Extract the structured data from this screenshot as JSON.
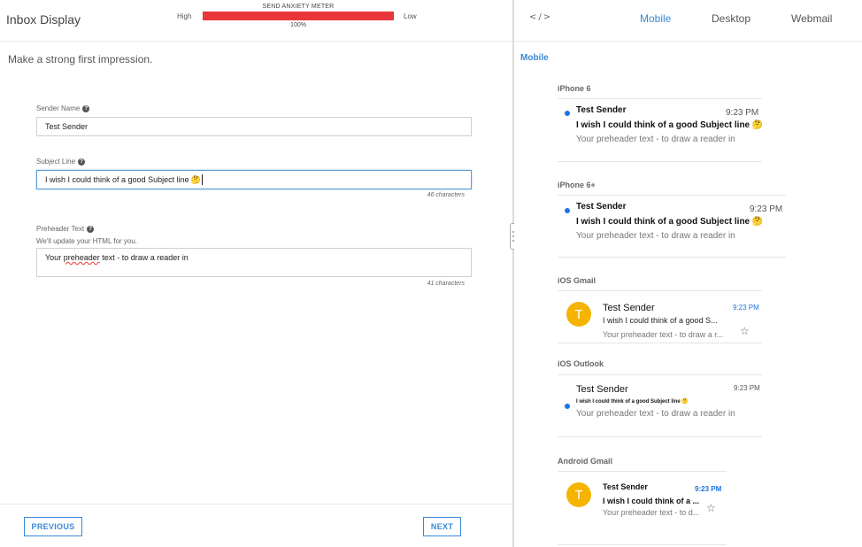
{
  "header": {
    "title": "Inbox Display",
    "meter": {
      "label": "SEND ANXIETY METER",
      "high": "High",
      "low": "Low",
      "percent_label": "100%",
      "percent": 100,
      "color": "#e8373b"
    }
  },
  "form": {
    "tagline": "Make a strong first impression.",
    "sender_name": {
      "label": "Sender Name",
      "value": "Test Sender"
    },
    "subject_line": {
      "label": "Subject Line",
      "value": "I wish I could think of a good Subject line",
      "emoji": "🤔",
      "count": "46 characters"
    },
    "preheader": {
      "label": "Preheader Text",
      "sublabel": "We'll update your HTML for you.",
      "value_prefix": "Your ",
      "value_misspelled": "preheader",
      "value_suffix": " text - to draw a reader in",
      "count": "41 characters"
    }
  },
  "nav": {
    "previous": "PREVIOUS",
    "next": "NEXT"
  },
  "preview": {
    "code_icon": "</>",
    "tabs": {
      "mobile": "Mobile",
      "desktop": "Desktop",
      "webmail": "Webmail"
    },
    "section_title": "Mobile",
    "accent": "#3a88d6",
    "devices": {
      "iphone6": {
        "label": "iPhone 6",
        "sender": "Test Sender",
        "time": "9:23 PM",
        "subject": "I wish I could think of a good Subject line",
        "emoji": "🤔",
        "preheader": "Your preheader text - to draw a reader in"
      },
      "iphone6plus": {
        "label": "iPhone 6+",
        "sender": "Test Sender",
        "time": "9:23 PM",
        "subject": "I wish I could think of a good Subject line",
        "emoji": "🤔",
        "preheader": "Your preheader text - to draw a reader in"
      },
      "ios_gmail": {
        "label": "iOS Gmail",
        "avatar": "T",
        "sender": "Test Sender",
        "time": "9:23 PM",
        "subject": "I wish I could think of a good S...",
        "preheader": "Your preheader text - to draw a r...",
        "star": "☆"
      },
      "ios_outlook": {
        "label": "iOS Outlook",
        "sender": "Test Sender",
        "time": "9:23 PM",
        "subject": "I wish I could think of a good Subject line",
        "emoji": "🤔",
        "preheader": "Your preheader text - to draw a reader in"
      },
      "android_gmail": {
        "label": "Android Gmail",
        "avatar": "T",
        "sender": "Test Sender",
        "time": "9:23 PM",
        "subject": "I wish I could think of a ...",
        "preheader": "Your preheader text - to d...",
        "star": "☆"
      }
    }
  }
}
